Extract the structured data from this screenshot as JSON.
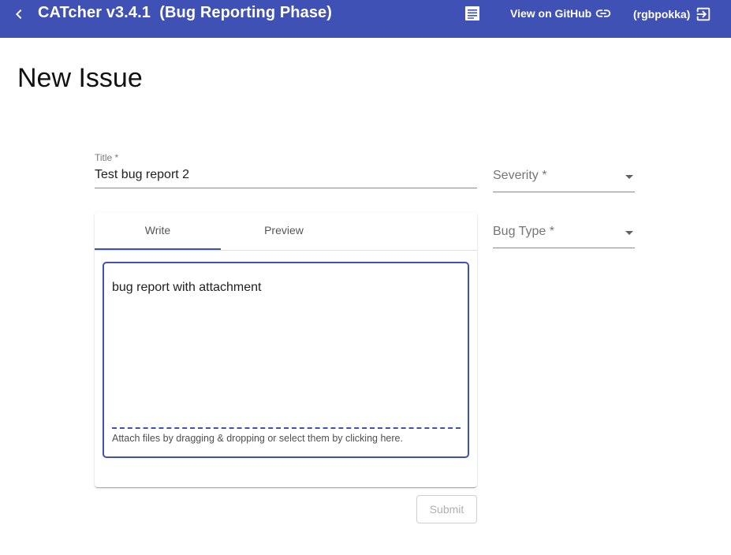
{
  "toolbar": {
    "back_icon": "chevron-left-icon",
    "app_title": "CATcher v3.4.1  (Bug Reporting Phase)",
    "doc_icon": "document-icon",
    "github_label": "View on GitHub",
    "github_icon": "link-icon",
    "user_label": "(rgbpokka)",
    "logout_icon": "logout-icon",
    "color": "#3f51b5"
  },
  "page": {
    "title": "New Issue"
  },
  "form": {
    "title_label": "Title *",
    "title_value": "Test bug report 2",
    "severity_label": "Severity *",
    "bug_type_label": "Bug Type *",
    "tabs": [
      {
        "label": "Write",
        "active": true
      },
      {
        "label": "Preview",
        "active": false
      }
    ],
    "description": "bug report with attachment",
    "attach_hint": "Attach files by dragging & dropping or select them by clicking here.",
    "submit_label": "Submit",
    "submit_enabled": false
  }
}
